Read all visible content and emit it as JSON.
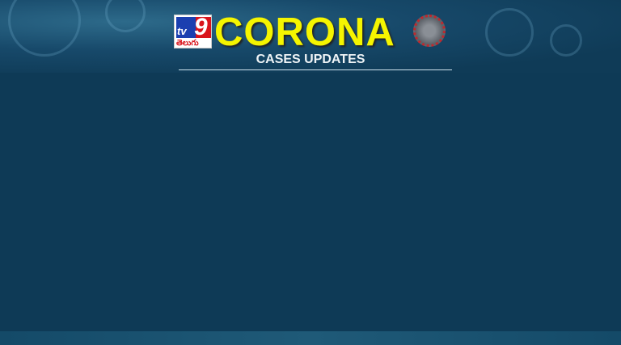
{
  "header": {
    "logo": {
      "brand": "TV9",
      "language": "తెలుగు"
    },
    "title": "CORONA",
    "subtitle": "CASES UPDATES"
  },
  "colors": {
    "title": "#f5f500",
    "panel": "#0e3a56",
    "logo_blue": "#1b3fb0",
    "logo_red": "#d9141c"
  }
}
